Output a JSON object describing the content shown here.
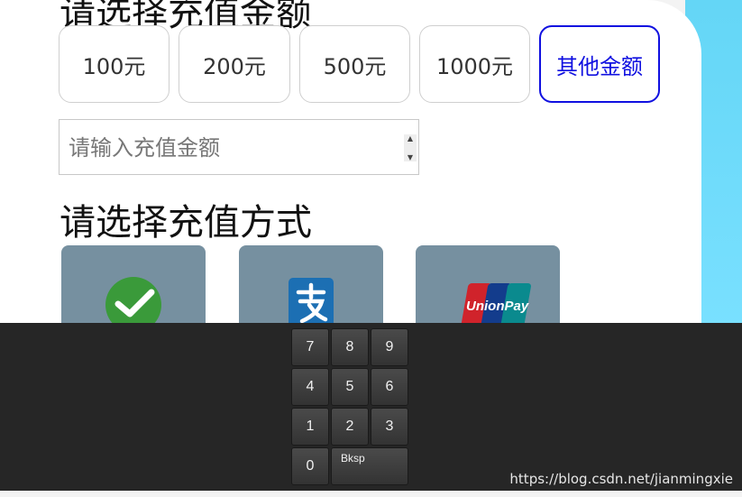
{
  "headings": {
    "select_amount": "请选择充值金额",
    "select_method": "请选择充值方式"
  },
  "amounts": [
    "100元",
    "200元",
    "500元",
    "1000元",
    "其他金额"
  ],
  "selected_amount": "其他金额",
  "amount_input": {
    "placeholder": "请输入充值金额",
    "value": ""
  },
  "payment_methods": [
    {
      "icon": "wechat-pay-icon"
    },
    {
      "icon": "alipay-icon"
    },
    {
      "icon": "unionpay-icon",
      "logo_text": "UnionPay"
    }
  ],
  "keypad": {
    "keys": [
      "7",
      "8",
      "9",
      "4",
      "5",
      "6",
      "1",
      "2",
      "3",
      "0"
    ],
    "backspace_label": "Bksp"
  },
  "watermark": "https://blog.csdn.net/jianmingxie",
  "colors": {
    "selected_accent": "#1010e0",
    "method_card_bg": "#7690a0",
    "keypad_bg": "#262626",
    "wechat_green": "#3a9a3a",
    "alipay_blue": "#1c6fb3",
    "background_cyan": "#6bd9f8"
  }
}
